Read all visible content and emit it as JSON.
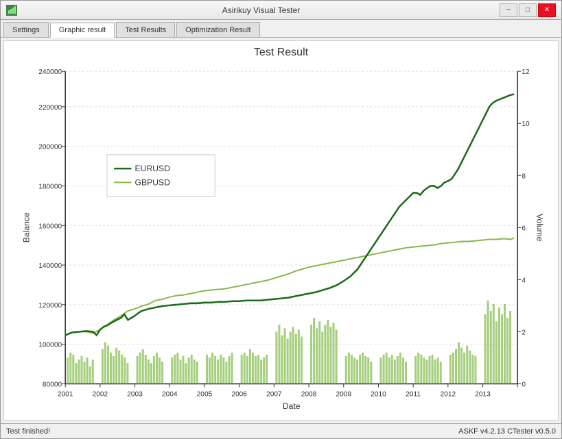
{
  "window": {
    "title": "Asirikuy Visual Tester",
    "icon": "chart-icon"
  },
  "titlebar_controls": {
    "minimize": "−",
    "restore": "□",
    "close": "✕"
  },
  "tabs": [
    {
      "id": "settings",
      "label": "Settings",
      "active": false
    },
    {
      "id": "graphic-result",
      "label": "Graphic result",
      "active": true
    },
    {
      "id": "test-results",
      "label": "Test Results",
      "active": false
    },
    {
      "id": "optimization-result",
      "label": "Optimization Result",
      "active": false
    }
  ],
  "chart": {
    "title": "Test Result",
    "x_axis_label": "Date",
    "y_axis_left_label": "Balance",
    "y_axis_right_label": "Volume",
    "y_left_ticks": [
      "80000",
      "100000",
      "120000",
      "140000",
      "160000",
      "180000",
      "200000",
      "220000",
      "240000"
    ],
    "y_right_ticks": [
      "0",
      "2",
      "4",
      "6",
      "8",
      "10",
      "12"
    ],
    "x_ticks": [
      "2001",
      "2002",
      "2003",
      "2004",
      "2005",
      "2006",
      "2007",
      "2008",
      "2009",
      "2010",
      "2011",
      "2012",
      "2013"
    ],
    "legend": [
      {
        "id": "eurusd",
        "label": "EURUSD",
        "color": "#1a6b1a",
        "style": "solid"
      },
      {
        "id": "gbpusd",
        "label": "GBPUSD",
        "color": "#8ab84a",
        "style": "solid"
      }
    ],
    "colors": {
      "eurusd_line": "#1a6b1a",
      "gbpusd_line": "#8ab84a",
      "bar": "#5a9c2a",
      "grid": "#dddddd"
    }
  },
  "status": {
    "left": "Test finished!",
    "right": "ASKF v4.2.13  CTester v0.5.0"
  }
}
